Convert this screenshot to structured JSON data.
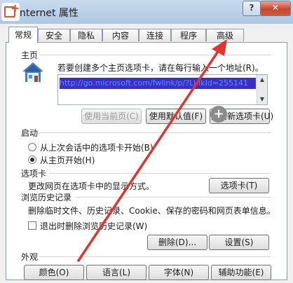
{
  "window": {
    "title": "nternet 属性",
    "help_label": "?",
    "close_label": "✕",
    "icon": "internet-options-icon"
  },
  "tabs": [
    {
      "label": "常规",
      "active": true
    },
    {
      "label": "安全"
    },
    {
      "label": "隐私"
    },
    {
      "label": "内容"
    },
    {
      "label": "连接"
    },
    {
      "label": "程序"
    },
    {
      "label": "高级"
    }
  ],
  "homepage": {
    "section_label": "主页",
    "instruction": "若要创建多个主页选项卡，请在每行输入一个地址(R)。",
    "url_value": "http://go.microsoft.com/fwlink/p/?LinkId=255141",
    "use_current": "使用当前页(C)",
    "use_default": "使用默认值(F)",
    "use_new_tab": "使用新选项卡(U)"
  },
  "startup": {
    "section_label": "启动",
    "option_last": "从上次会话中的选项卡开始(B)",
    "option_home": "从主页开始(H)",
    "selected": "option_home"
  },
  "tabs_section": {
    "section_label": "选项卡",
    "description": "更改网页在选项卡中的显示方式。",
    "button": "选项卡(T)"
  },
  "history": {
    "section_label": "浏览历史记录",
    "description": "删除临时文件、历史记录、Cookie、保存的密码和网页表单信息。",
    "checkbox_label": "退出时删除浏览历史记录(W)",
    "checkbox_checked": false,
    "delete_button": "删除(D)...",
    "settings_button": "设置(S)"
  },
  "appearance": {
    "section_label": "外观",
    "colors_button": "颜色(O)",
    "languages_button": "语言(L)",
    "fonts_button": "字体(N)",
    "accessibility_button": "辅助功能(E)"
  },
  "annotation": {
    "arrow_color": "#e0342c",
    "target": "高级"
  }
}
